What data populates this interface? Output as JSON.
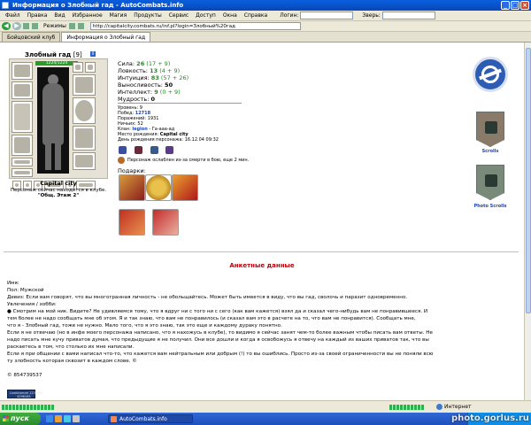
{
  "window": {
    "title": "Информация о Злобный гад - AutoCombats.info"
  },
  "menu": {
    "items": [
      "Файл",
      "Правка",
      "Вид",
      "Избранное",
      "Магия",
      "Продукты",
      "Сервис",
      "Доступ",
      "Окна",
      "Справка"
    ],
    "login_label": "Логин:",
    "beast_label": "Зверь:"
  },
  "toolbar": {
    "modes_label": "Режимы",
    "address": "http://capitalcity.combats.ru/inf.pl?login=Злобный%20гад"
  },
  "tabs": [
    {
      "label": "Бойцовский клуб"
    },
    {
      "label": "Информация о Злобный гад"
    }
  ],
  "character": {
    "name": "Злобный гад",
    "level": "[9]",
    "info_glyph": "i",
    "hp": "1224/1224",
    "city": "Capital city",
    "location": "Персонаж сейчас находится в клубе.",
    "room": "\"Общ. Этаж 2\""
  },
  "stats": [
    {
      "label": "Сила:",
      "value": "26",
      "extra": "(17 + 9)"
    },
    {
      "label": "Ловкость:",
      "value": "13",
      "extra": "(4 + 9)"
    },
    {
      "label": "Интуиция:",
      "value": "83",
      "extra": "(57 + 26)"
    },
    {
      "label": "Выносливость:",
      "value": "50",
      "extra": ""
    },
    {
      "label": "Интеллект:",
      "value": "9",
      "extra": "(0 + 9)"
    },
    {
      "label": "Мудрость:",
      "value": "0",
      "extra": ""
    }
  ],
  "info": {
    "level_label": "Уровень:",
    "level_value": "9",
    "wins_label": "Побед:",
    "wins_value": "12718",
    "losses_label": "Поражений:",
    "losses_value": "1931",
    "draws_label": "Ничьих:",
    "draws_value": "52",
    "clan_label": "Клан:",
    "clan_name": "legion",
    "clan_name2": "Га-ааа-ад",
    "birthplace_label": "Место рождения:",
    "birthplace_value": "Capital city",
    "birthday_label": "День рождения персонажа:",
    "birthday_value": "16.12.04 09:32",
    "weakened_text": "Персонаж ослаблен из-за смерти в бою, еще 2 мин."
  },
  "gifts_label": "Подарки:",
  "banners": {
    "scrolls_label": "Scrolls",
    "photo_scrolls_label": "Photo Scrolls"
  },
  "anket": {
    "title": "Анкетные данные",
    "name_label": "Имя:",
    "gender_label": "Пол:",
    "gender_value": "Мужской",
    "motto_label": "Девиз:",
    "motto_value": "Если вам говорят, что вы многогранная личность - не обольщайтесь. Может быть имеется в виду, что вы гад, сволочь и паразит одновременно.",
    "hobby_label": "Увлечения / хобби:",
    "hobby_lines": [
      "● Смотрим на мой ник. Видите? Не удивляемся тому, что я вдруг ни с того ни с сего (как вам кажется) взял да и сказал чего-нибудь вам не понравившееся. И",
      "тем более не надо сообщать мне об этом. Я и так знаю, что вам не понравилось (и сказал вам это в расчете на то, что вам не понравится). Сообщать мне,",
      "что я - Злобный гад, тоже не нужно. Мало того, что я это знаю, так это еще и каждому дураку понятно.",
      "Если я не отвечаю (но в инфе моего персонажа написано, что я нахожусь в клубе), то видимо я сейчас занят чем-то более важным чтобы писать вам ответы. Не",
      "надо писать мне кучу приватов думая, что предыдущие я не получил. Они все дошли и когда я освобожусь я отвечу на каждый из ваших приватов так, что вы",
      "раскаетесь в том, что столько их мне написали.",
      "Если я при общении с вами написал что-то, что кажется вам нейтральным или добрым (!) то вы ошиблись. Просто из-за своей ограниченности вы не поняли всю",
      "ту злобность которая сквозит в каждом слове. ©"
    ],
    "icq": "© 854739537"
  },
  "counter": {
    "line1": "LiveInternet 1234567",
    "line2": "4296165"
  },
  "status": {
    "zone": "Интернет"
  },
  "taskbar": {
    "start": "пуск",
    "task": "AutoCombats.info"
  },
  "watermark": "photo.gorlus.ru"
}
